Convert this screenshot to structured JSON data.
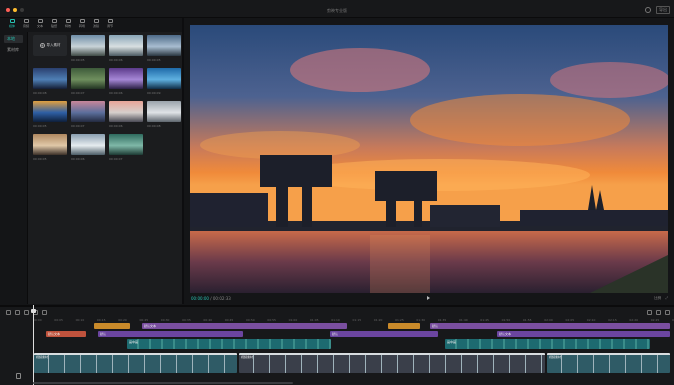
{
  "window": {
    "title": "剪映专业版",
    "export_label": "导出",
    "traffic_lights": [
      "#ff5f57",
      "#febc2e",
      "#3a3a3a"
    ]
  },
  "toolbar": {
    "tabs": [
      {
        "label": "媒体",
        "icon": "media-icon",
        "active": true
      },
      {
        "label": "音频",
        "icon": "audio-icon",
        "active": false
      },
      {
        "label": "文本",
        "icon": "text-icon",
        "active": false
      },
      {
        "label": "贴纸",
        "icon": "sticker-icon",
        "active": false
      },
      {
        "label": "特效",
        "icon": "effects-icon",
        "active": false
      },
      {
        "label": "转场",
        "icon": "transition-icon",
        "active": false
      },
      {
        "label": "滤镜",
        "icon": "filter-icon",
        "active": false
      },
      {
        "label": "调节",
        "icon": "adjust-icon",
        "active": false
      }
    ]
  },
  "leftnav": {
    "items": [
      {
        "label": "本地",
        "active": true
      },
      {
        "label": "素材库",
        "active": false
      }
    ]
  },
  "media": {
    "import_label": "导入素材",
    "thumbnails": [
      {
        "label": "00:00:05",
        "palette": [
          "#6f8ea8",
          "#c9d3d8",
          "#3f4a45"
        ]
      },
      {
        "label": "00:00:06",
        "palette": [
          "#8aa6b8",
          "#d8dfe1",
          "#4b5a62"
        ]
      },
      {
        "label": "00:00:05",
        "palette": [
          "#4d6a88",
          "#a8bdd0",
          "#2a3640"
        ]
      },
      {
        "label": "00:00:08",
        "palette": [
          "#2a3f6e",
          "#4f7fb5",
          "#141d33"
        ]
      },
      {
        "label": "00:00:07",
        "palette": [
          "#3d5a3a",
          "#6f8f5e",
          "#223322"
        ]
      },
      {
        "label": "00:00:06",
        "palette": [
          "#5b3a8a",
          "#a687d6",
          "#2b1f44"
        ]
      },
      {
        "label": "00:00:09",
        "palette": [
          "#1e6aa8",
          "#5fb0e0",
          "#0f2c45"
        ]
      },
      {
        "label": "00:00:05",
        "palette": [
          "#e0a040",
          "#2e5fa5",
          "#0e1f3a"
        ]
      },
      {
        "label": "00:00:07",
        "palette": [
          "#c8869a",
          "#5c6f9c",
          "#232a40"
        ]
      },
      {
        "label": "00:00:06",
        "palette": [
          "#e8a598",
          "#d6d0cc",
          "#4a4a55"
        ]
      },
      {
        "label": "00:00:08",
        "palette": [
          "#9aa3ab",
          "#dfe3e6",
          "#5e666e"
        ]
      },
      {
        "label": "00:00:05",
        "palette": [
          "#b08860",
          "#e0c8a8",
          "#3c3028"
        ]
      },
      {
        "label": "00:00:06",
        "palette": [
          "#8a9fb0",
          "#e6ecef",
          "#4b5c66"
        ]
      },
      {
        "label": "00:00:07",
        "palette": [
          "#2f6b5e",
          "#7fb8a8",
          "#1c3a33"
        ]
      }
    ]
  },
  "preview": {
    "timecode_current": "00:00:00",
    "timecode_total": "00:02:33",
    "ratio_label": "比例",
    "fullscreen_label": "⤢"
  },
  "timeline": {
    "ruler_ticks": [
      "00:00",
      "00:05",
      "00:10",
      "00:15",
      "00:20",
      "00:25",
      "00:30",
      "00:35",
      "00:40",
      "00:45",
      "00:50",
      "00:55",
      "01:00",
      "01:05",
      "01:10",
      "01:15",
      "01:20",
      "01:25",
      "01:30",
      "01:35",
      "01:40",
      "01:45",
      "01:50",
      "01:55",
      "02:00",
      "02:05",
      "02:10",
      "02:15",
      "02:20",
      "02:25",
      "02:30"
    ],
    "text_clips_row1": [
      {
        "label": "",
        "color": "#c98a2a"
      },
      {
        "label": "默认文本",
        "color": "#7a4fa0"
      },
      {
        "label": "",
        "color": "#c98a2a"
      },
      {
        "label": "默认",
        "color": "#7a4fa0"
      }
    ],
    "text_clips_row2": [
      {
        "label": "默认文本",
        "color": "#c0533d"
      },
      {
        "label": "默认",
        "color": "#6b45a0"
      },
      {
        "label": "默认",
        "color": "#6b45a0"
      },
      {
        "label": "默认文本",
        "color": "#6b45a0"
      }
    ],
    "overlay_clips": [
      {
        "label": "画中画",
        "color": "#1d6a70"
      },
      {
        "label": "画中画",
        "color": "#1d6a70"
      }
    ],
    "main_clips": [
      {
        "label": "视频素材",
        "color": "#2f5b66"
      },
      {
        "label": "视频素材",
        "color": "#3a3f4a"
      },
      {
        "label": "视频素材",
        "color": "#2f5b66"
      }
    ]
  }
}
